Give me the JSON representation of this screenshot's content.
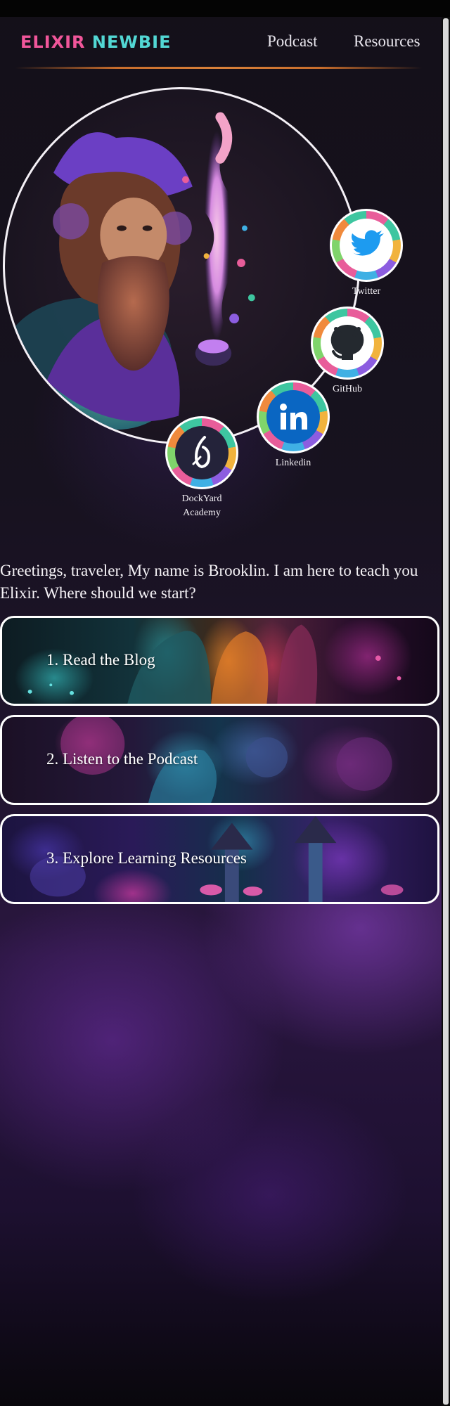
{
  "brand": {
    "word1": "ELIXIR",
    "word2": "NEWBIE"
  },
  "nav": {
    "links": [
      "Podcast",
      "Resources"
    ]
  },
  "social": [
    {
      "label": "Twitter",
      "icon": "twitter-bird-icon",
      "color": "#1d9bf0"
    },
    {
      "label": "GitHub",
      "icon": "github-octocat-icon",
      "color": "#24292f"
    },
    {
      "label": "Linkedin",
      "icon": "linkedin-logo-icon",
      "color": "#0a66c2"
    },
    {
      "label": "DockYard Academy",
      "label_line1": "DockYard",
      "label_line2": "Academy",
      "icon": "dockyard-academy-icon",
      "color": "#24233a"
    }
  ],
  "greeting": "Greetings, traveler, My name is Brooklin. I am here to teach you Elixir. Where should we start?",
  "cards": [
    {
      "label": "1. Read the Blog"
    },
    {
      "label": "2. Listen to the Podcast"
    },
    {
      "label": "3. Explore Learning Resources"
    }
  ],
  "colors": {
    "brand_pink": "#f0569a",
    "brand_teal": "#52d7d4",
    "nav_rule": "#c86d2c",
    "background": "#17121f",
    "accent_purple": "#8e44c9"
  }
}
